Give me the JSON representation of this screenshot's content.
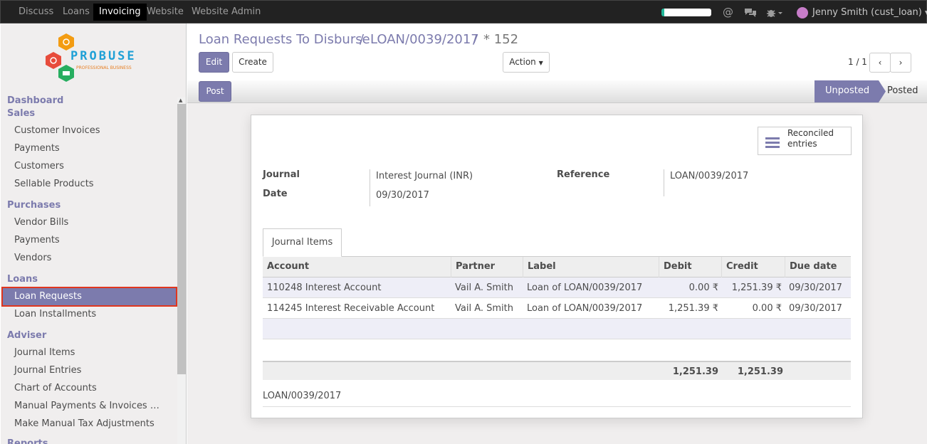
{
  "topbar": {
    "menus": [
      "Discuss",
      "Loans",
      "Invoicing",
      "Website",
      "Website Admin"
    ],
    "active_menu": "Invoicing",
    "user": "Jenny Smith (cust_loan)"
  },
  "sidebar": {
    "logo_text": "PROBUSE",
    "logo_subtext": "PROFESSIONAL BUSINESS",
    "dashboard": "Dashboard",
    "sales": {
      "title": "Sales",
      "items": [
        "Customer Invoices",
        "Payments",
        "Customers",
        "Sellable Products"
      ]
    },
    "purchases": {
      "title": "Purchases",
      "items": [
        "Vendor Bills",
        "Payments",
        "Vendors"
      ]
    },
    "loans": {
      "title": "Loans",
      "items": [
        "Loan Requests",
        "Loan Installments"
      ]
    },
    "adviser": {
      "title": "Adviser",
      "items": [
        "Journal Items",
        "Journal Entries",
        "Chart of Accounts",
        "Manual Payments & Invoices …",
        "Make Manual Tax Adjustments"
      ]
    },
    "reports": "Reports"
  },
  "breadcrumb": {
    "root": "Loan Requests To Disburse",
    "sep": "/",
    "middle": "LOAN/0039/2017",
    "current": "* 152"
  },
  "buttons": {
    "edit": "Edit",
    "create": "Create",
    "action": "Action",
    "post": "Post"
  },
  "pager": {
    "value": "1 / 1"
  },
  "status": {
    "steps": [
      "Unposted",
      "Posted"
    ],
    "current": "Unposted"
  },
  "smart_button": {
    "line1": "Reconciled",
    "line2": "entries"
  },
  "form": {
    "journal_label": "Journal",
    "journal": "Interest Journal (INR)",
    "date_label": "Date",
    "date": "09/30/2017",
    "reference_label": "Reference",
    "reference": "LOAN/0039/2017"
  },
  "tab": {
    "label": "Journal Items"
  },
  "table": {
    "headers": [
      "Account",
      "Partner",
      "Label",
      "Debit",
      "Credit",
      "Due date"
    ],
    "rows": [
      [
        "110248 Interest Account",
        "Vail A. Smith",
        "Loan of LOAN/0039/2017",
        "0.00 ₹",
        "1,251.39 ₹",
        "09/30/2017"
      ],
      [
        "114245 Interest Receivable Account",
        "Vail A. Smith",
        "Loan of LOAN/0039/2017",
        "1,251.39 ₹",
        "0.00 ₹",
        "09/30/2017"
      ]
    ],
    "totals": {
      "debit": "1,251.39",
      "credit": "1,251.39"
    }
  },
  "narration": "LOAN/0039/2017",
  "colors": {
    "accent": "#7c7bad",
    "topbar": "#222222",
    "highlight_border": "#e0361e"
  }
}
